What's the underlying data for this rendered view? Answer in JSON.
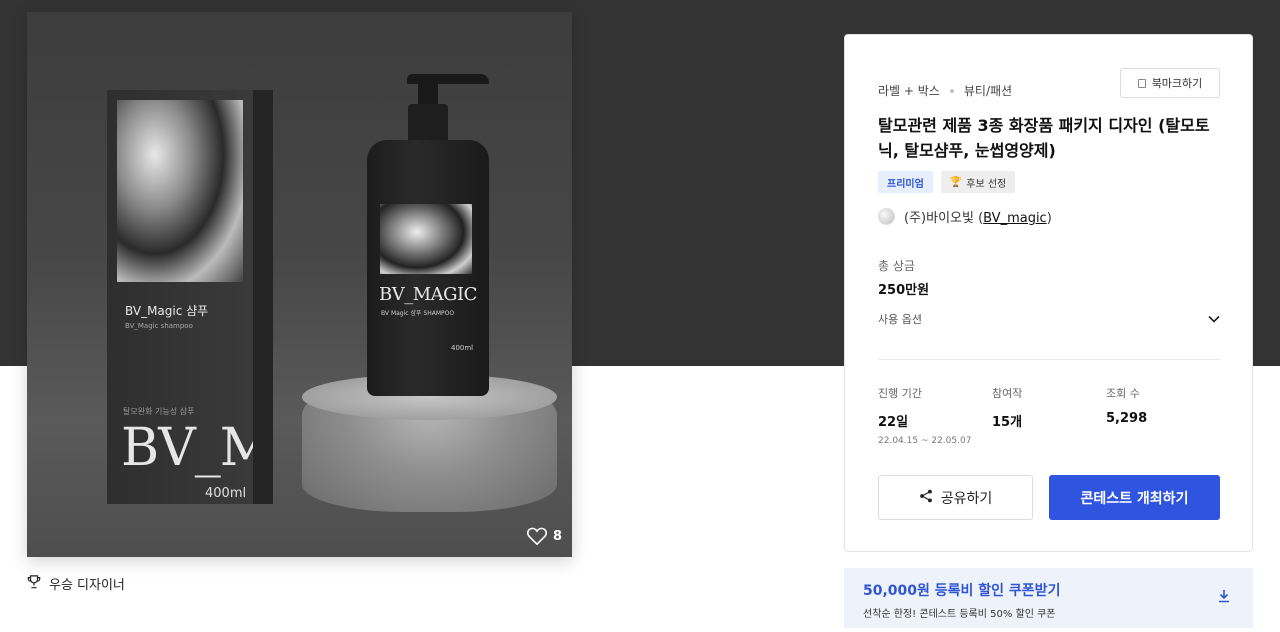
{
  "hero": {
    "box_title": "BV_Magic 샴푸",
    "box_sub": "BV_Magic shampoo",
    "box_small": "탈모완화 기능성 샴푸",
    "box_big": "BV_M",
    "box_volume": "400ml",
    "bottle_brand": "BV_MAGIC",
    "bottle_line": "BV Magic 샴푸     SHAMPOO",
    "bottle_volume": "400ml",
    "likes": "8"
  },
  "winner_label": "우승 디자이너",
  "panel": {
    "category": "라벨 + 박스",
    "subcategory": "뷰티/패션",
    "bookmark_label": "북마크하기",
    "title": "탈모관련 제품 3종 화장품 패키지 디자인 (탈모토닉, 탈모샴푸, 눈썹영양제)",
    "badge_premium": "프리미엄",
    "badge_candidate": "후보 선정",
    "host_prefix": "(주)바이오빛 (",
    "host_link": "BV_magic",
    "host_suffix": ")",
    "prize_label": "총 상금",
    "prize_value": "250만원",
    "options_label": "사용 옵션",
    "stats": {
      "period_label": "진행 기간",
      "period_value": "22일",
      "period_range": "22.04.15  ~  22.05.07",
      "participants_label": "참여작",
      "participants_value": "15개",
      "views_label": "조회 수",
      "views_value": "5,298"
    },
    "share_label": "공유하기",
    "host_button_label": "콘테스트 개최하기"
  },
  "coupon": {
    "title": "50,000원 등록비 할인 쿠폰받기",
    "subtitle": "선착순 한정! 콘테스트 등록비 50% 할인 쿠폰"
  },
  "colors": {
    "accent": "#2f55e0",
    "top_band": "#333333",
    "coupon_bg": "#eef2fb"
  }
}
